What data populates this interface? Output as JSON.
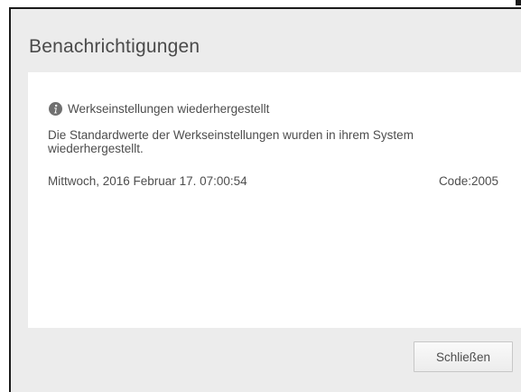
{
  "dialog": {
    "title": "Benachrichtigungen",
    "notification": {
      "icon": "info-icon",
      "heading": "Werkseinstellungen wiederhergestellt",
      "message": "Die Standardwerte der Werkseinstellungen wurden in ihrem System wiederhergestellt.",
      "datetime": "Mittwoch, 2016 Februar 17. 07:00:54",
      "code": "Code:2005"
    },
    "close_label": "Schließen"
  },
  "colors": {
    "dialog_background": "#ececec",
    "panel_background": "#ffffff",
    "text": "#4d4d4d",
    "icon": "#707070"
  }
}
